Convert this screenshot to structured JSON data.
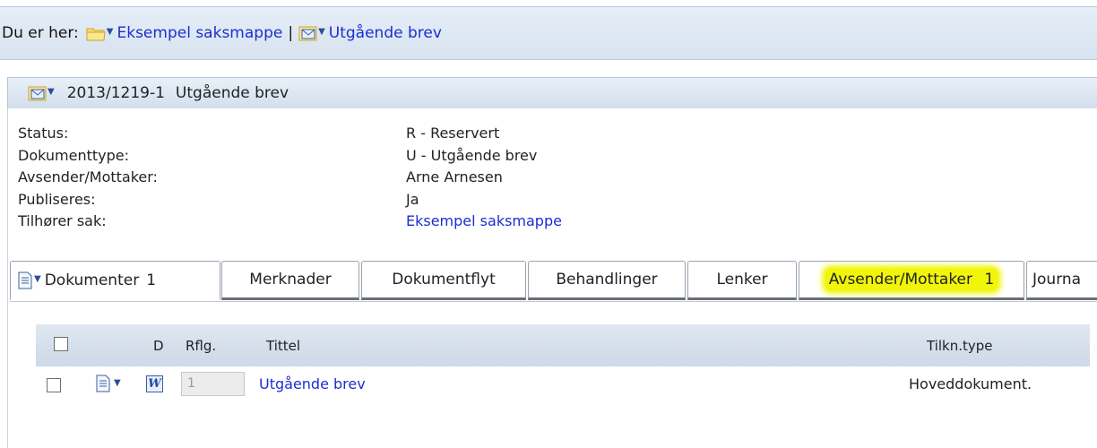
{
  "breadcrumb": {
    "prefix": "Du er her:",
    "items": [
      {
        "label": "Eksempel saksmappe",
        "icon": "folder-icon"
      },
      {
        "label": "Utgående brev",
        "icon": "envelope-icon"
      }
    ],
    "separator": "|"
  },
  "document": {
    "number": "2013/1219-1",
    "title": "Utgående brev",
    "icon": "envelope-icon"
  },
  "metadata": [
    {
      "key": "Status:",
      "value": "R - Reservert"
    },
    {
      "key": "Dokumenttype:",
      "value": "U - Utgående brev"
    },
    {
      "key": "Avsender/Mottaker:",
      "value": "Arne Arnesen"
    },
    {
      "key": "Publiseres:",
      "value": "Ja"
    },
    {
      "key": "Tilhører sak:",
      "value": "Eksempel saksmappe"
    }
  ],
  "tabs": [
    {
      "label": "Dokumenter",
      "count": "1"
    },
    {
      "label": "Merknader"
    },
    {
      "label": "Dokumentflyt"
    },
    {
      "label": "Behandlinger"
    },
    {
      "label": "Lenker"
    },
    {
      "label": "Avsender/Mottaker",
      "count": "1"
    },
    {
      "label": "Journa"
    }
  ],
  "table": {
    "columns": [
      "D",
      "Rflg.",
      "Tittel",
      "Tilkn.type"
    ],
    "rows": [
      {
        "rflg": "1",
        "title": "Utgående brev",
        "type": "Hoveddokument."
      }
    ]
  },
  "colors": {
    "link": "#1b2fcf",
    "highlight": "#f3f516",
    "bar": "#d7e3f0"
  }
}
